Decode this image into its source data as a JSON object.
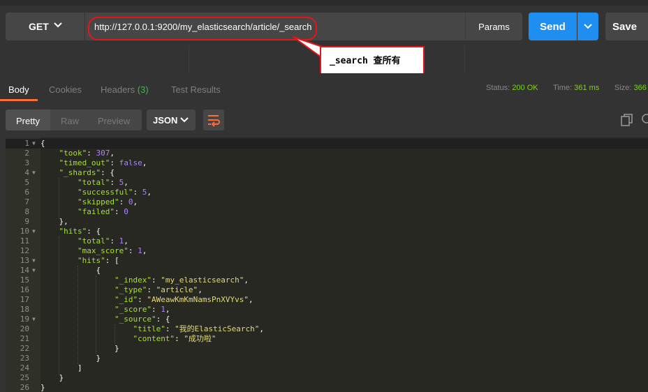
{
  "request": {
    "method": "GET",
    "url": "http://127.0.0.1:9200/my_elasticsearch/article/_search",
    "params_label": "Params",
    "send_label": "Send",
    "save_label": "Save"
  },
  "annotation": {
    "text": "_search 查所有"
  },
  "response_tabs": {
    "body": "Body",
    "cookies": "Cookies",
    "headers": "Headers",
    "headers_count": "(3)",
    "test_results": "Test Results"
  },
  "status": {
    "status_label": "Status:",
    "status_value": "200 OK",
    "time_label": "Time:",
    "time_value": "361 ms",
    "size_label": "Size:",
    "size_value": "366"
  },
  "view": {
    "pretty": "Pretty",
    "raw": "Raw",
    "preview": "Preview",
    "format": "JSON"
  },
  "colors": {
    "accent": "#ff6c37",
    "send": "#1f8ef1",
    "annotation_border": "#e3161b",
    "status_ok": "#7ed321"
  },
  "code_lines": [
    {
      "n": "1",
      "fold": true,
      "parts": [
        [
          "p",
          "{"
        ]
      ]
    },
    {
      "n": "2",
      "parts": [
        [
          "p",
          "    "
        ],
        [
          "k",
          "\"took\""
        ],
        [
          "p",
          ": "
        ],
        [
          "n",
          "307"
        ],
        [
          "p",
          ","
        ]
      ]
    },
    {
      "n": "3",
      "parts": [
        [
          "p",
          "    "
        ],
        [
          "k",
          "\"timed_out\""
        ],
        [
          "p",
          ": "
        ],
        [
          "n",
          "false"
        ],
        [
          "p",
          ","
        ]
      ]
    },
    {
      "n": "4",
      "fold": true,
      "parts": [
        [
          "p",
          "    "
        ],
        [
          "k",
          "\"_shards\""
        ],
        [
          "p",
          ": {"
        ]
      ]
    },
    {
      "n": "5",
      "parts": [
        [
          "p",
          "        "
        ],
        [
          "k",
          "\"total\""
        ],
        [
          "p",
          ": "
        ],
        [
          "n",
          "5"
        ],
        [
          "p",
          ","
        ]
      ]
    },
    {
      "n": "6",
      "parts": [
        [
          "p",
          "        "
        ],
        [
          "k",
          "\"successful\""
        ],
        [
          "p",
          ": "
        ],
        [
          "n",
          "5"
        ],
        [
          "p",
          ","
        ]
      ]
    },
    {
      "n": "7",
      "parts": [
        [
          "p",
          "        "
        ],
        [
          "k",
          "\"skipped\""
        ],
        [
          "p",
          ": "
        ],
        [
          "n",
          "0"
        ],
        [
          "p",
          ","
        ]
      ]
    },
    {
      "n": "8",
      "parts": [
        [
          "p",
          "        "
        ],
        [
          "k",
          "\"failed\""
        ],
        [
          "p",
          ": "
        ],
        [
          "n",
          "0"
        ]
      ]
    },
    {
      "n": "9",
      "parts": [
        [
          "p",
          "    },"
        ]
      ]
    },
    {
      "n": "10",
      "fold": true,
      "parts": [
        [
          "p",
          "    "
        ],
        [
          "k",
          "\"hits\""
        ],
        [
          "p",
          ": {"
        ]
      ]
    },
    {
      "n": "11",
      "parts": [
        [
          "p",
          "        "
        ],
        [
          "k",
          "\"total\""
        ],
        [
          "p",
          ": "
        ],
        [
          "n",
          "1"
        ],
        [
          "p",
          ","
        ]
      ]
    },
    {
      "n": "12",
      "parts": [
        [
          "p",
          "        "
        ],
        [
          "k",
          "\"max_score\""
        ],
        [
          "p",
          ": "
        ],
        [
          "n",
          "1"
        ],
        [
          "p",
          ","
        ]
      ]
    },
    {
      "n": "13",
      "fold": true,
      "parts": [
        [
          "p",
          "        "
        ],
        [
          "k",
          "\"hits\""
        ],
        [
          "p",
          ": ["
        ]
      ]
    },
    {
      "n": "14",
      "fold": true,
      "parts": [
        [
          "p",
          "            {"
        ]
      ]
    },
    {
      "n": "15",
      "parts": [
        [
          "p",
          "                "
        ],
        [
          "k",
          "\"_index\""
        ],
        [
          "p",
          ": "
        ],
        [
          "s",
          "\"my_elasticsearch\""
        ],
        [
          "p",
          ","
        ]
      ]
    },
    {
      "n": "16",
      "parts": [
        [
          "p",
          "                "
        ],
        [
          "k",
          "\"_type\""
        ],
        [
          "p",
          ": "
        ],
        [
          "s",
          "\"article\""
        ],
        [
          "p",
          ","
        ]
      ]
    },
    {
      "n": "17",
      "parts": [
        [
          "p",
          "                "
        ],
        [
          "k",
          "\"_id\""
        ],
        [
          "p",
          ": "
        ],
        [
          "s",
          "\"AWeawKmKmNamsPnXVYvs\""
        ],
        [
          "p",
          ","
        ]
      ]
    },
    {
      "n": "18",
      "parts": [
        [
          "p",
          "                "
        ],
        [
          "k",
          "\"_score\""
        ],
        [
          "p",
          ": "
        ],
        [
          "n",
          "1"
        ],
        [
          "p",
          ","
        ]
      ]
    },
    {
      "n": "19",
      "fold": true,
      "parts": [
        [
          "p",
          "                "
        ],
        [
          "k",
          "\"_source\""
        ],
        [
          "p",
          ": {"
        ]
      ]
    },
    {
      "n": "20",
      "parts": [
        [
          "p",
          "                    "
        ],
        [
          "k",
          "\"title\""
        ],
        [
          "p",
          ": "
        ],
        [
          "s",
          "\"我的ElasticSearch\""
        ],
        [
          "p",
          ","
        ]
      ]
    },
    {
      "n": "21",
      "parts": [
        [
          "p",
          "                    "
        ],
        [
          "k",
          "\"content\""
        ],
        [
          "p",
          ": "
        ],
        [
          "s",
          "\"成功啦\""
        ]
      ]
    },
    {
      "n": "22",
      "parts": [
        [
          "p",
          "                }"
        ]
      ]
    },
    {
      "n": "23",
      "parts": [
        [
          "p",
          "            }"
        ]
      ]
    },
    {
      "n": "24",
      "parts": [
        [
          "p",
          "        ]"
        ]
      ]
    },
    {
      "n": "25",
      "parts": [
        [
          "p",
          "    }"
        ]
      ]
    },
    {
      "n": "26",
      "parts": [
        [
          "p",
          "}"
        ]
      ]
    }
  ]
}
